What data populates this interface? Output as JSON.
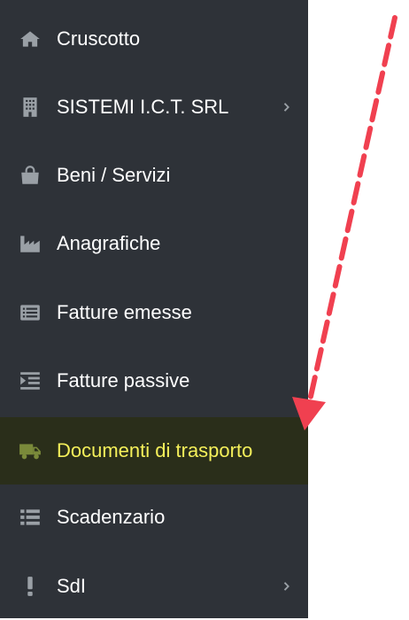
{
  "sidebar": {
    "items": [
      {
        "label": "Cruscotto",
        "icon": "home-icon"
      },
      {
        "label": "SISTEMI I.C.T. SRL",
        "icon": "building-icon",
        "has_submenu": true
      },
      {
        "label": "Beni / Servizi",
        "icon": "shopping-bag-icon"
      },
      {
        "label": "Anagrafiche",
        "icon": "industry-icon"
      },
      {
        "label": "Fatture emesse",
        "icon": "list-alt-icon"
      },
      {
        "label": "Fatture passive",
        "icon": "indent-icon"
      },
      {
        "label": "Documenti di trasporto",
        "icon": "truck-icon",
        "active": true
      },
      {
        "label": "Scadenzario",
        "icon": "list-icon"
      },
      {
        "label": "SdI",
        "icon": "exclamation-icon",
        "has_submenu": true
      }
    ]
  },
  "colors": {
    "sidebar_bg": "#2e3238",
    "icon": "#9aa0a6",
    "active_bg": "#2a2e1a",
    "active_text": "#f5f05a",
    "active_icon": "#7a8a3a",
    "annotation_arrow": "#f04050"
  }
}
